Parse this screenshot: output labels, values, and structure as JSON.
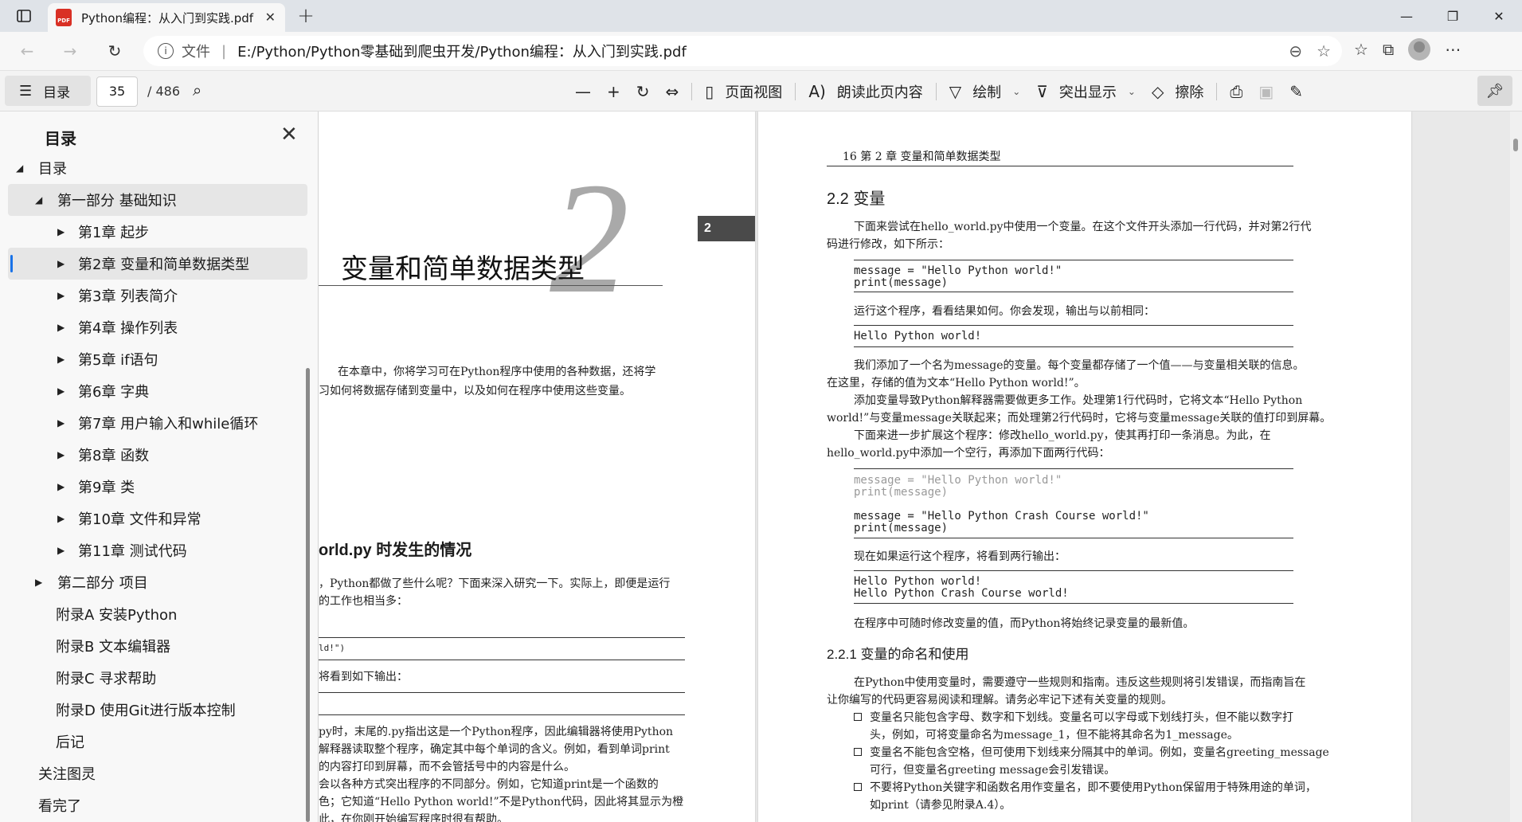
{
  "tab": {
    "title": "Python编程：从入门到实践.pdf",
    "badge": "PDF",
    "close": "✕",
    "new": "+"
  },
  "window": {
    "minimize": "—",
    "maximize": "❐",
    "close": "✕"
  },
  "address": {
    "file_label": "文件",
    "separator": "|",
    "url": "E:/Python/Python零基础到爬虫开发/Python编程：从入门到实践.pdf"
  },
  "pdf_toolbar": {
    "toc_label": "目录",
    "page_current": "35",
    "page_total": "/ 486",
    "page_view": "页面视图",
    "read_aloud": "朗读此页内容",
    "draw": "绘制",
    "highlight": "突出显示",
    "erase": "擦除"
  },
  "sidebar": {
    "title": "目录",
    "items": [
      {
        "label": "目录",
        "level": 0,
        "arrow": "◢"
      },
      {
        "label": "第一部分 基础知识",
        "level": 1,
        "arrow": "◢"
      },
      {
        "label": "第1章 起步",
        "level": 2,
        "arrow": "▶"
      },
      {
        "label": "第2章 变量和简单数据类型",
        "level": 2,
        "arrow": "▶"
      },
      {
        "label": "第3章 列表简介",
        "level": 2,
        "arrow": "▶"
      },
      {
        "label": "第4章 操作列表",
        "level": 2,
        "arrow": "▶"
      },
      {
        "label": "第5章 if语句",
        "level": 2,
        "arrow": "▶"
      },
      {
        "label": "第6章 字典",
        "level": 2,
        "arrow": "▶"
      },
      {
        "label": "第7章 用户输入和while循环",
        "level": 2,
        "arrow": "▶"
      },
      {
        "label": "第8章 函数",
        "level": 2,
        "arrow": "▶"
      },
      {
        "label": "第9章 类",
        "level": 2,
        "arrow": "▶"
      },
      {
        "label": "第10章 文件和异常",
        "level": 2,
        "arrow": "▶"
      },
      {
        "label": "第11章 测试代码",
        "level": 2,
        "arrow": "▶"
      },
      {
        "label": "第二部分 项目",
        "level": 1,
        "arrow": "▶"
      },
      {
        "label": "附录A 安装Python",
        "level": 1,
        "arrow": ""
      },
      {
        "label": "附录B 文本编辑器",
        "level": 1,
        "arrow": ""
      },
      {
        "label": "附录C 寻求帮助",
        "level": 1,
        "arrow": ""
      },
      {
        "label": "附录D 使用Git进行版本控制",
        "level": 1,
        "arrow": ""
      },
      {
        "label": "后记",
        "level": 1,
        "arrow": ""
      },
      {
        "label": "关注图灵",
        "level": 0,
        "arrow": ""
      },
      {
        "label": "看完了",
        "level": 0,
        "arrow": ""
      }
    ]
  },
  "left_page": {
    "chapter_number": "2",
    "chapter_title": "变量和简单数据类型",
    "chapter_tag": "2",
    "intro_1": "在本章中，你将学习可在Python程序中使用的各种数据，还将学",
    "intro_2": "习如何将数据存储到变量中，以及如何在程序中使用这些变量。",
    "heading": "orld.py 时发生的情况",
    "p1": "，Python都做了些什么呢？下面来深入研究一下。实际上，即便是运行",
    "p2": "的工作也相当多：",
    "code1": "ld!\")",
    "p3": "将看到如下输出：",
    "p4": "py时，末尾的.py指出这是一个Python程序，因此编辑器将使用Python",
    "p5": "解释器读取整个程序，确定其中每个单词的含义。例如，看到单词print",
    "p6": "的内容打印到屏幕，而不会管括号中的内容是什么。",
    "p7": "会以各种方式突出程序的不同部分。例如，它知道print是一个函数的",
    "p8": "色；它知道“Hello Python world!”不是Python代码，因此将其显示为橙",
    "p9": "此，在你刚开始编写程序时很有帮助。"
  },
  "right_page": {
    "header": "16    第 2 章   变量和简单数据类型",
    "h2": "2.2   变量",
    "s1": "下面来尝试在hello_world.py中使用一个变量。在这个文件开头添加一行代码，并对第2行代",
    "s2": "码进行修改，如下所示：",
    "code1a": "message = \"Hello Python world!\"",
    "code1b": "print(message)",
    "s3": "运行这个程序，看看结果如何。你会发现，输出与以前相同：",
    "code2": "Hello Python world!",
    "s4": "我们添加了一个名为message的变量。每个变量都存储了一个值——与变量相关联的信息。",
    "s5": "在这里，存储的值为文本“Hello Python world!”。",
    "s6": "添加变量导致Python解释器需要做更多工作。处理第1行代码时，它将文本“Hello Python",
    "s7": "world!”与变量message关联起来；而处理第2行代码时，它将与变量message关联的值打印到屏幕。",
    "s8": "下面来进一步扩展这个程序：修改hello_world.py，使其再打印一条消息。为此，在",
    "s9": "hello_world.py中添加一个空行，再添加下面两行代码：",
    "code3a": "message = \"Hello Python world!\"",
    "code3b": "print(message)",
    "code3c": "message = \"Hello Python Crash Course world!\"",
    "code3d": "print(message)",
    "s10": "现在如果运行这个程序，将看到两行输出：",
    "code4a": "Hello Python world!",
    "code4b": "Hello Python Crash Course world!",
    "s11": "在程序中可随时修改变量的值，而Python将始终记录变量的最新值。",
    "h3": "2.2.1   变量的命名和使用",
    "s12": "在Python中使用变量时，需要遵守一些规则和指南。违反这些规则将引发错误，而指南旨在",
    "s13": "让你编写的代码更容易阅读和理解。请务必牢记下述有关变量的规则。",
    "b1a": "变量名只能包含字母、数字和下划线。变量名可以字母或下划线打头，但不能以数字打",
    "b1b": "头，例如，可将变量命名为message_1，但不能将其命名为1_message。",
    "b2a": "变量名不能包含空格，但可使用下划线来分隔其中的单词。例如，变量名greeting_message",
    "b2b": "可行，但变量名greeting message会引发错误。",
    "b3a": "不要将Python关键字和函数名用作变量名，即不要使用Python保留用于特殊用途的单词，",
    "b3b": "如print（请参见附录A.4）。"
  }
}
